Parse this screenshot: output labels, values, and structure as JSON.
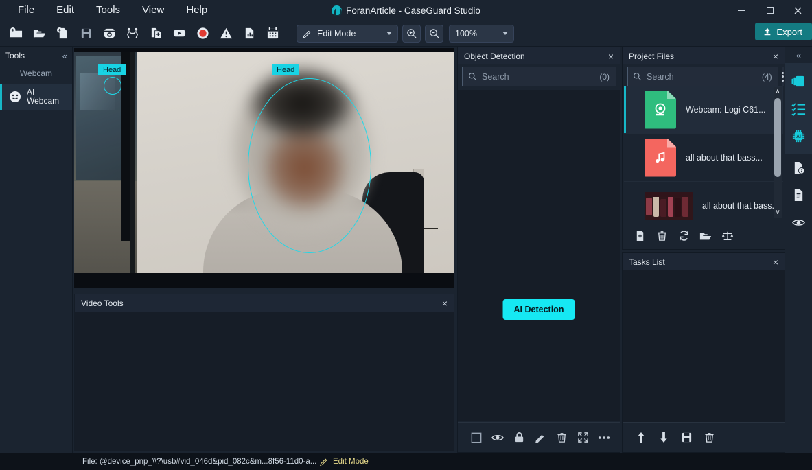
{
  "window": {
    "title": "ForanArticle - CaseGuard Studio",
    "logo": "caseguard-logo-icon",
    "minimize": "minimize-icon",
    "maximize": "maximize-icon",
    "close": "close-icon"
  },
  "menubar": {
    "items": [
      {
        "label": "File"
      },
      {
        "label": "Edit"
      },
      {
        "label": "Tools"
      },
      {
        "label": "View"
      },
      {
        "label": "Help"
      }
    ]
  },
  "toolbar": {
    "icons": [
      {
        "name": "new-project-icon"
      },
      {
        "name": "open-folder-icon"
      },
      {
        "name": "new-file-icon"
      },
      {
        "name": "save-icon"
      },
      {
        "name": "webcam-icon"
      },
      {
        "name": "people-transfer-icon"
      },
      {
        "name": "add-document-icon"
      },
      {
        "name": "youtube-icon"
      },
      {
        "name": "record-icon"
      },
      {
        "name": "warning-icon"
      },
      {
        "name": "report-chart-icon"
      },
      {
        "name": "calendar-icon"
      }
    ],
    "mode": {
      "label": "Edit Mode",
      "icon": "pencil-icon"
    },
    "zoom_in": "zoom-in-icon",
    "zoom_out": "zoom-out-icon",
    "zoom_level": "100%",
    "export": {
      "label": "Export",
      "icon": "export-upload-icon",
      "color": "#147b82"
    }
  },
  "tools_panel": {
    "title": "Tools",
    "collapse": "«",
    "category": "Webcam",
    "item": {
      "line1": "AI",
      "line2": "Webcam",
      "icon": "smiley-face-icon"
    }
  },
  "video": {
    "detections": [
      {
        "label": "Head"
      },
      {
        "label": "Head"
      }
    ],
    "accent": "#18d3e4"
  },
  "video_tools": {
    "title": "Video Tools",
    "close": "×"
  },
  "object_detection": {
    "title": "Object Detection",
    "close": "×",
    "search": {
      "placeholder": "Search",
      "value": "",
      "count": "(0)",
      "icon": "search-icon"
    },
    "ai_button": {
      "label": "AI Detection",
      "color": "#16e8f3"
    },
    "tools": [
      {
        "name": "select-all-icon"
      },
      {
        "name": "eye-icon"
      },
      {
        "name": "lock-icon"
      },
      {
        "name": "pencil-icon"
      },
      {
        "name": "trash-icon"
      },
      {
        "name": "expand-icon"
      },
      {
        "name": "more-options-icon"
      }
    ]
  },
  "project_files": {
    "title": "Project Files",
    "close": "×",
    "search": {
      "placeholder": "Search",
      "value": "",
      "count": "(4)",
      "icon": "search-icon"
    },
    "menu": "kebab-menu-icon",
    "files": [
      {
        "name": "Webcam: Logi C61...",
        "icon": "webcam-file-icon",
        "color": "#2fbd7e",
        "selected": true
      },
      {
        "name": "all about that bass...",
        "icon": "audio-file-icon",
        "color": "#f4665f",
        "selected": false
      },
      {
        "name": "all about that bass...",
        "icon": "video-thumbnail",
        "color": "#8e3040",
        "selected": false
      }
    ],
    "tools": [
      {
        "name": "add-file-icon"
      },
      {
        "name": "trash-icon"
      },
      {
        "name": "refresh-icon"
      },
      {
        "name": "open-folder-icon"
      },
      {
        "name": "compare-scales-icon"
      }
    ],
    "scroll_up": "∧",
    "scroll_down": "∨"
  },
  "tasks_list": {
    "title": "Tasks List",
    "close": "×",
    "tools": [
      {
        "name": "move-up-icon"
      },
      {
        "name": "move-down-icon"
      },
      {
        "name": "save-icon"
      },
      {
        "name": "trash-icon"
      }
    ]
  },
  "right_rail": {
    "collapse": "«",
    "icons": [
      {
        "name": "panels-icon",
        "active": true
      },
      {
        "name": "checklist-icon",
        "active": true
      },
      {
        "name": "ai-chip-icon",
        "active": true
      },
      {
        "name": "file-info-icon",
        "active": false
      },
      {
        "name": "document-icon",
        "active": false
      },
      {
        "name": "eye-icon",
        "active": false
      }
    ],
    "accent": "#18d3e4"
  },
  "statusbar": {
    "file": "File: @device_pnp_\\\\?\\usb#vid_046d&pid_082c&m...8f56-11d0-a...",
    "mode": "Edit Mode",
    "mode_icon": "pencil-icon",
    "mode_color": "#e6d98a"
  }
}
